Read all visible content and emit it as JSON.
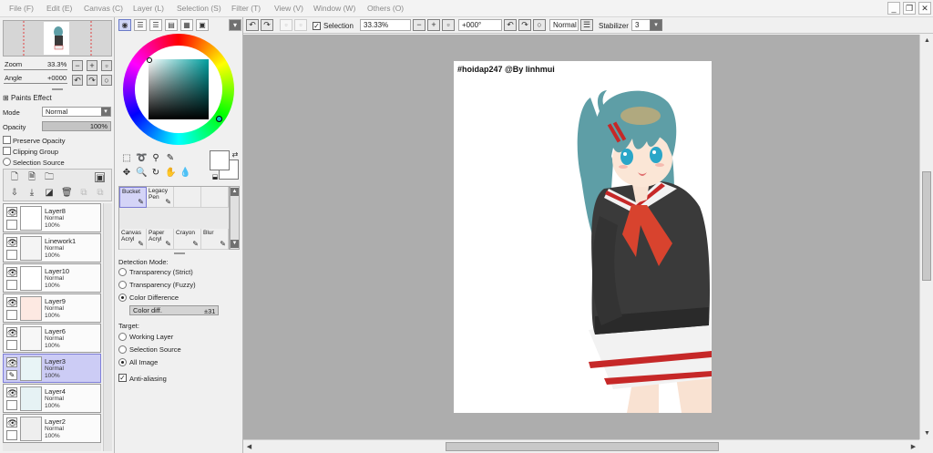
{
  "menu": {
    "items": [
      "File (F)",
      "Edit (E)",
      "Canvas (C)",
      "Layer (L)",
      "Selection (S)",
      "Filter (T)",
      "View (V)",
      "Window (W)",
      "Others (O)"
    ],
    "minimize": "_",
    "restore": "❐",
    "close": "✕"
  },
  "navigator": {
    "zoom_label": "Zoom",
    "zoom_value": "33.3%",
    "angle_label": "Angle",
    "angle_value": "+0000"
  },
  "layer_props": {
    "paints_effect": "Paints Effect",
    "mode_label": "Mode",
    "mode_value": "Normal",
    "opacity_label": "Opacity",
    "opacity_value": "100%",
    "preserve_opacity": "Preserve Opacity",
    "clipping_group": "Clipping Group",
    "selection_source": "Selection Source"
  },
  "layers": [
    {
      "name": "Layer8",
      "mode": "Normal",
      "opacity": "100%",
      "selected": false
    },
    {
      "name": "Linework1",
      "mode": "Normal",
      "opacity": "100%",
      "selected": false
    },
    {
      "name": "Layer10",
      "mode": "Normal",
      "opacity": "100%",
      "selected": false
    },
    {
      "name": "Layer9",
      "mode": "Normal",
      "opacity": "100%",
      "selected": false
    },
    {
      "name": "Layer6",
      "mode": "Normal",
      "opacity": "100%",
      "selected": false
    },
    {
      "name": "Layer3",
      "mode": "Normal",
      "opacity": "100%",
      "selected": true
    },
    {
      "name": "Layer4",
      "mode": "Normal",
      "opacity": "100%",
      "selected": false
    },
    {
      "name": "Layer2",
      "mode": "Normal",
      "opacity": "100%",
      "selected": false
    }
  ],
  "brushes": [
    {
      "label": "Bucket",
      "selected": true
    },
    {
      "label": "Legacy\nPen",
      "selected": false
    },
    {
      "label": "",
      "selected": false
    },
    {
      "label": "",
      "selected": false
    },
    {
      "label": "Canvas\nAcryl",
      "selected": false
    },
    {
      "label": "Paper\nAcryl",
      "selected": false
    },
    {
      "label": "Crayon",
      "selected": false
    },
    {
      "label": "Blur",
      "selected": false
    }
  ],
  "bucket": {
    "detection_label": "Detection Mode:",
    "detection_options": [
      "Transparency (Strict)",
      "Transparency (Fuzzy)",
      "Color Difference"
    ],
    "detection_selected": 2,
    "color_diff_label": "Color diff.",
    "color_diff_value": "±31",
    "target_label": "Target:",
    "target_options": [
      "Working Layer",
      "Selection Source",
      "All Image"
    ],
    "target_selected": 2,
    "anti_aliasing": "Anti-aliasing"
  },
  "toolbar": {
    "selection_label": "Selection",
    "zoom_value": "33.33%",
    "rotation_value": "+000°",
    "blend_value": "Normal",
    "stabilizer_label": "Stabilizer",
    "stabilizer_value": "3"
  },
  "canvas": {
    "caption": "#hoidap247 @By linhmui"
  },
  "colors": {
    "selected_layer": "#ccccf5",
    "canvas_bg": "#adadad",
    "hair": "#5e9ea6",
    "sweater": "#3a3a3a",
    "scarf": "#d8432e"
  }
}
